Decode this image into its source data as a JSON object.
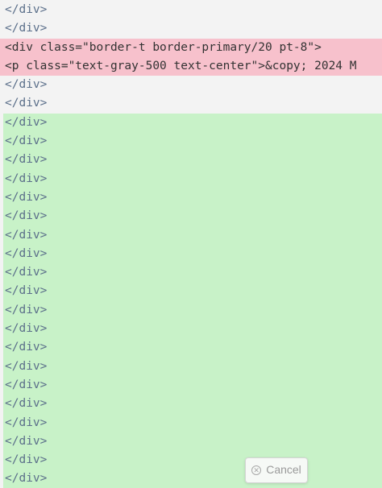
{
  "diff": {
    "lines": [
      {
        "type": "context",
        "text": "</div>"
      },
      {
        "type": "context",
        "text": "</div>"
      },
      {
        "type": "removed",
        "text": "<div class=\"border-t border-primary/20 pt-8\">"
      },
      {
        "type": "removed",
        "text": "<p class=\"text-gray-500 text-center\">&copy; 2024 M"
      },
      {
        "type": "context",
        "text": "</div>"
      },
      {
        "type": "context",
        "text": "</div>"
      },
      {
        "type": "added",
        "text": "</div>"
      },
      {
        "type": "added",
        "text": "</div>"
      },
      {
        "type": "added",
        "text": "</div>"
      },
      {
        "type": "added",
        "text": "</div>"
      },
      {
        "type": "added",
        "text": "</div>"
      },
      {
        "type": "added",
        "text": "</div>"
      },
      {
        "type": "added",
        "text": "</div>"
      },
      {
        "type": "added",
        "text": "</div>"
      },
      {
        "type": "added",
        "text": "</div>"
      },
      {
        "type": "added",
        "text": "</div>"
      },
      {
        "type": "added",
        "text": "</div>"
      },
      {
        "type": "added",
        "text": "</div>"
      },
      {
        "type": "added",
        "text": "</div>"
      },
      {
        "type": "added",
        "text": "</div>"
      },
      {
        "type": "added",
        "text": "</div>"
      },
      {
        "type": "added",
        "text": "</div>"
      },
      {
        "type": "added",
        "text": "</div>"
      },
      {
        "type": "added",
        "text": "</div>"
      },
      {
        "type": "added",
        "text": "</div>"
      },
      {
        "type": "added",
        "text": "</div>"
      }
    ]
  },
  "cancel_button": {
    "label": "Cancel",
    "icon": "close-circle-icon"
  },
  "colors": {
    "removed_bg": "#f7c1cc",
    "added_bg": "#c8f2c8",
    "tag_text": "#5b6f8a"
  }
}
